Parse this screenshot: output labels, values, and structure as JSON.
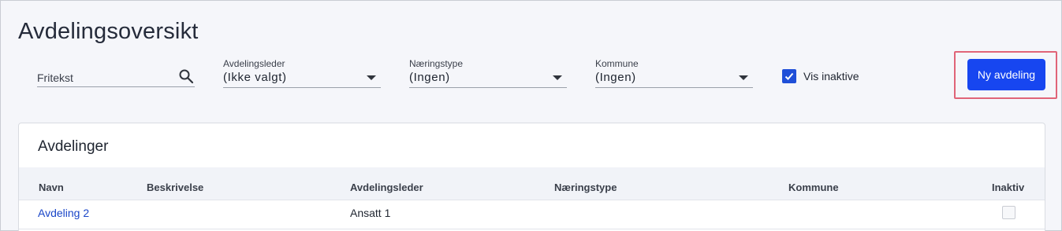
{
  "page": {
    "title": "Avdelingsoversikt"
  },
  "filters": {
    "search": {
      "placeholder": "Fritekst",
      "value": ""
    },
    "manager": {
      "label": "Avdelingsleder",
      "value": "(Ikke valgt)"
    },
    "industry": {
      "label": "Næringstype",
      "value": "(Ingen)"
    },
    "municipality": {
      "label": "Kommune",
      "value": "(Ingen)"
    },
    "show_inactive": {
      "label": "Vis inaktive",
      "checked": true
    }
  },
  "actions": {
    "new_department": "Ny avdeling"
  },
  "table": {
    "title": "Avdelinger",
    "columns": [
      "Navn",
      "Beskrivelse",
      "Avdelingsleder",
      "Næringstype",
      "Kommune",
      "Inaktiv"
    ],
    "rows": [
      {
        "name": "Avdeling 2",
        "description": "",
        "manager": "Ansatt 1",
        "industry": "",
        "municipality": "",
        "inactive": false
      }
    ]
  },
  "colors": {
    "accent": "#1746f0",
    "highlight": "#e06478",
    "link": "#1a46c8"
  },
  "icons": {
    "search": "search-icon",
    "dropdown": "chevron-down-icon",
    "check": "check-icon"
  }
}
